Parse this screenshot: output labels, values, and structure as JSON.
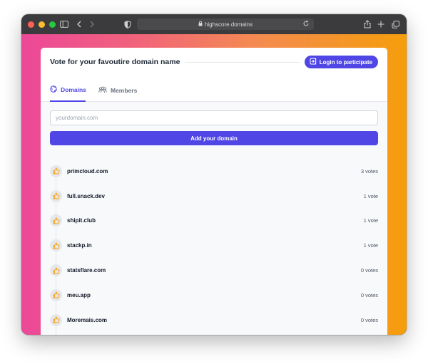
{
  "browser": {
    "url": "highscore.domains"
  },
  "header": {
    "title": "Vote for your favoutire domain name",
    "login_label": "Login to participate"
  },
  "tabs": [
    {
      "label": "Domains",
      "icon": "globe-icon"
    },
    {
      "label": "Members",
      "icon": "users-icon"
    }
  ],
  "form": {
    "placeholder": "yourdomain.com",
    "value": "",
    "add_label": "Add your domain"
  },
  "domains": [
    {
      "name": "primcloud.com",
      "votes": "3 votes"
    },
    {
      "name": "full.snack.dev",
      "votes": "1 vote"
    },
    {
      "name": "shipit.club",
      "votes": "1 vote"
    },
    {
      "name": "stackp.in",
      "votes": "1 vote"
    },
    {
      "name": "statsflare.com",
      "votes": "0 votes"
    },
    {
      "name": "meu.app",
      "votes": "0 votes"
    },
    {
      "name": "Moremais.com",
      "votes": "0 votes"
    }
  ],
  "colors": {
    "accent": "#4f46e5",
    "gradient_start": "#ec4899",
    "gradient_end": "#f59e0b",
    "thumb_icon": "#f59e0b"
  }
}
